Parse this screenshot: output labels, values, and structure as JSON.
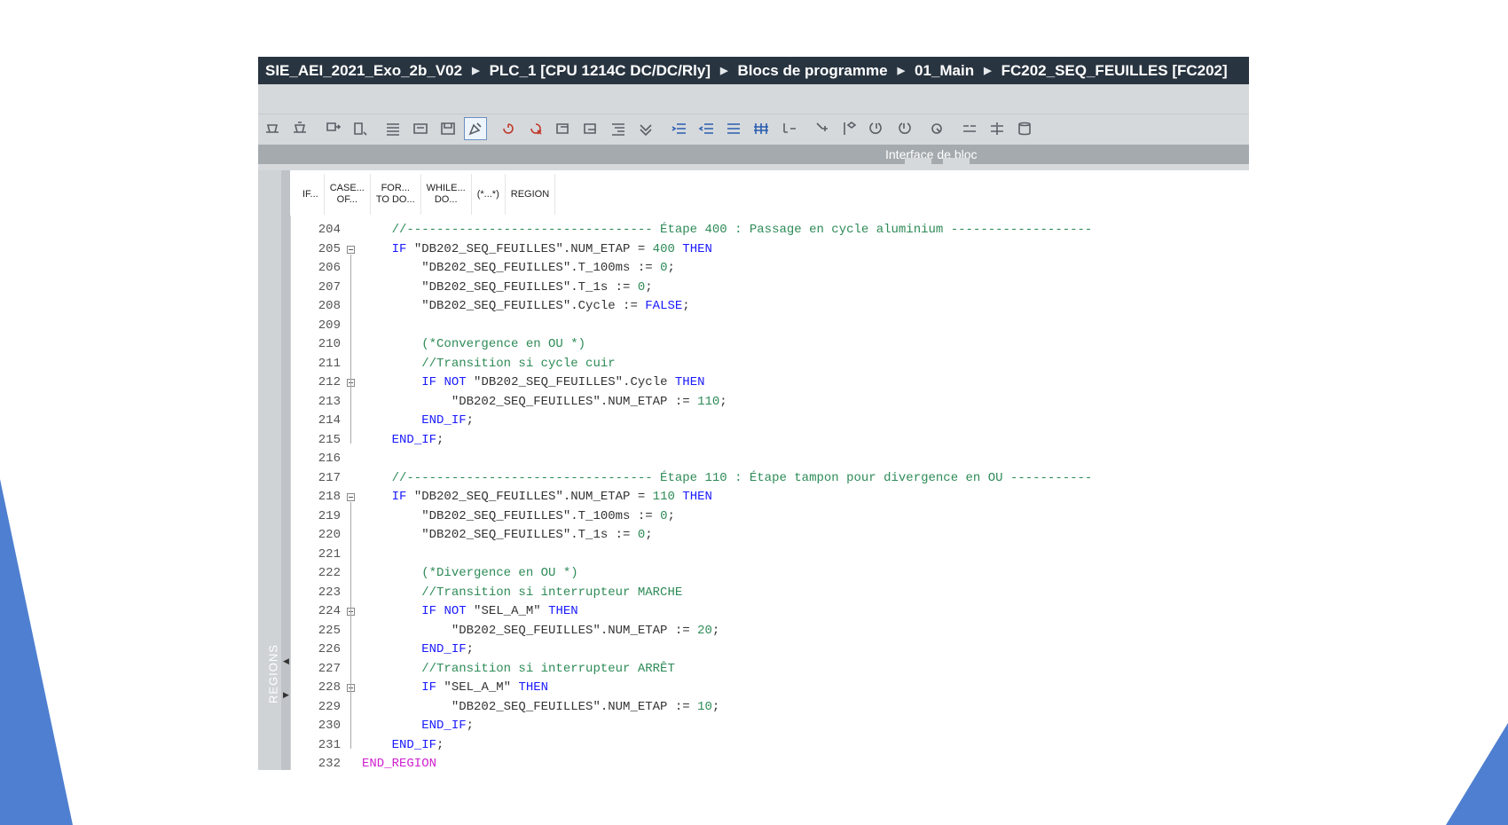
{
  "breadcrumb": [
    "SIE_AEI_2021_Exo_2b_V02",
    "PLC_1 [CPU 1214C DC/DC/Rly]",
    "Blocs de programme",
    "01_Main",
    "FC202_SEQ_FEUILLES [FC202]"
  ],
  "toolbar_icons": [
    "compile-icon",
    "compile-all-icon",
    "download-icon",
    "go-online-icon",
    "list-icon",
    "block-icon",
    "save-icon",
    "highlight-icon",
    "insert-network-icon",
    "delete-network-icon",
    "open-all-icon",
    "close-all-icon",
    "comment-icon",
    "verify-icon",
    "indent-icon",
    "outdent-icon",
    "unindent-icon",
    "align-icon",
    "move-up-icon",
    "move-down-icon",
    "bookmark-icon",
    "next-bookmark-icon",
    "prev-bookmark-icon",
    "watch-icon",
    "compare-icon",
    "compare-offline-icon",
    "database-icon"
  ],
  "interface_bar": {
    "label": "Interface de bloc"
  },
  "sidebar": {
    "regions_label": "REGIONS"
  },
  "snippets": [
    {
      "line1": "IF...",
      "line2": ""
    },
    {
      "line1": "CASE...",
      "line2": "OF..."
    },
    {
      "line1": "FOR...",
      "line2": "TO DO..."
    },
    {
      "line1": "WHILE...",
      "line2": "DO..."
    },
    {
      "line1": "(*...*)",
      "line2": ""
    },
    {
      "line1": "REGION",
      "line2": ""
    }
  ],
  "code_lines": [
    {
      "n": "204",
      "t": "    //--------------------------------- Étape 400 : Passage en cycle aluminium -------------------"
    },
    {
      "n": "205",
      "t": "    IF \"DB202_SEQ_FEUILLES\".NUM_ETAP = 400 THEN"
    },
    {
      "n": "206",
      "t": "        \"DB202_SEQ_FEUILLES\".T_100ms := 0;"
    },
    {
      "n": "207",
      "t": "        \"DB202_SEQ_FEUILLES\".T_1s := 0;"
    },
    {
      "n": "208",
      "t": "        \"DB202_SEQ_FEUILLES\".Cycle := FALSE;"
    },
    {
      "n": "209",
      "t": ""
    },
    {
      "n": "210",
      "t": "        (*Convergence en OU *)"
    },
    {
      "n": "211",
      "t": "        //Transition si cycle cuir"
    },
    {
      "n": "212",
      "t": "        IF NOT \"DB202_SEQ_FEUILLES\".Cycle THEN"
    },
    {
      "n": "213",
      "t": "            \"DB202_SEQ_FEUILLES\".NUM_ETAP := 110;"
    },
    {
      "n": "214",
      "t": "        END_IF;"
    },
    {
      "n": "215",
      "t": "    END_IF;"
    },
    {
      "n": "216",
      "t": ""
    },
    {
      "n": "217",
      "t": "    //--------------------------------- Étape 110 : Étape tampon pour divergence en OU -----------"
    },
    {
      "n": "218",
      "t": "    IF \"DB202_SEQ_FEUILLES\".NUM_ETAP = 110 THEN"
    },
    {
      "n": "219",
      "t": "        \"DB202_SEQ_FEUILLES\".T_100ms := 0;"
    },
    {
      "n": "220",
      "t": "        \"DB202_SEQ_FEUILLES\".T_1s := 0;"
    },
    {
      "n": "221",
      "t": ""
    },
    {
      "n": "222",
      "t": "        (*Divergence en OU *)"
    },
    {
      "n": "223",
      "t": "        //Transition si interrupteur MARCHE"
    },
    {
      "n": "224",
      "t": "        IF NOT \"SEL_A_M\" THEN"
    },
    {
      "n": "225",
      "t": "            \"DB202_SEQ_FEUILLES\".NUM_ETAP := 20;"
    },
    {
      "n": "226",
      "t": "        END_IF;"
    },
    {
      "n": "227",
      "t": "        //Transition si interrupteur ARRÊT"
    },
    {
      "n": "228",
      "t": "        IF \"SEL_A_M\" THEN"
    },
    {
      "n": "229",
      "t": "            \"DB202_SEQ_FEUILLES\".NUM_ETAP := 10;"
    },
    {
      "n": "230",
      "t": "        END_IF;"
    },
    {
      "n": "231",
      "t": "    END_IF;"
    },
    {
      "n": "232",
      "t": "END_REGION"
    }
  ],
  "fold_lines": [
    "205",
    "212",
    "218",
    "224",
    "228"
  ],
  "colors": {
    "keyword": "#1a1aff",
    "comment": "#2e8b57",
    "number": "#2e8b57",
    "region": "#d020d0",
    "titlebar": "#283440",
    "background_shape": "#4f7fd0"
  }
}
